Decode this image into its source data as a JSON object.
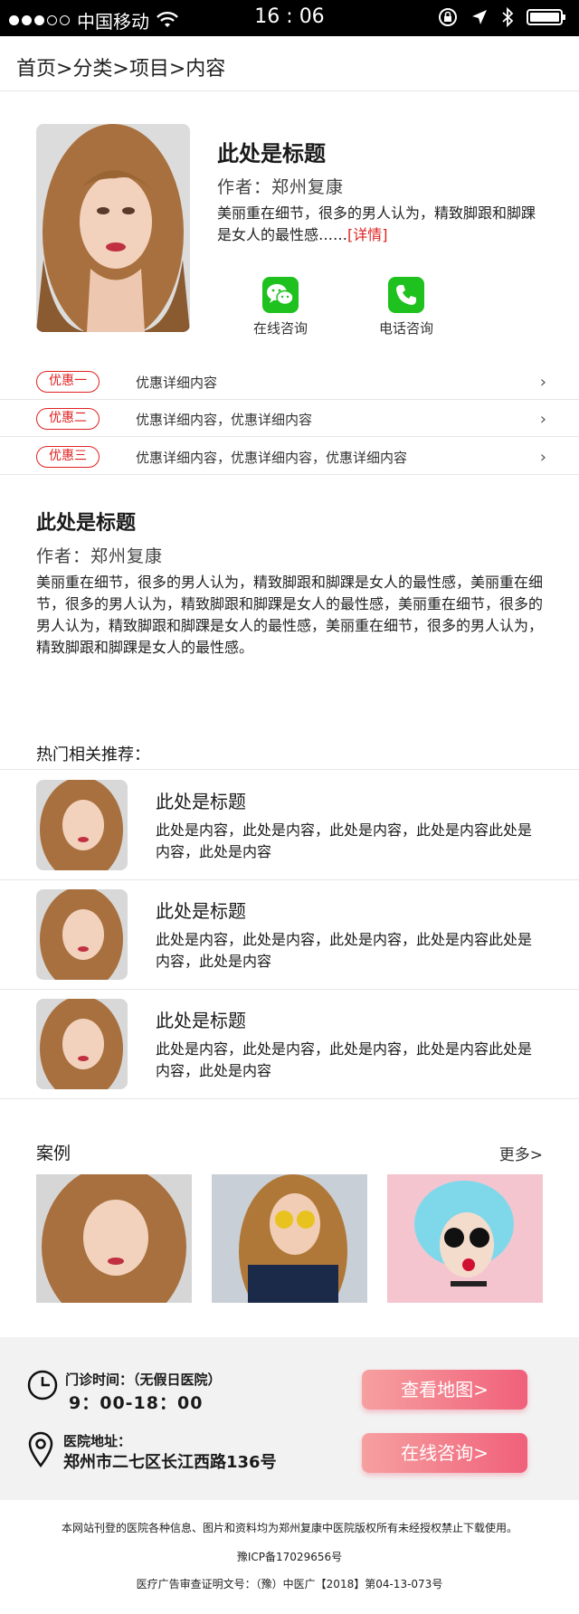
{
  "status_bar": {
    "carrier": "中国移动",
    "time": "16 : 06"
  },
  "breadcrumb": "首页>分类>项目>内容",
  "hero": {
    "title": "此处是标题",
    "author": "作者：郑州复康",
    "description": "美丽重在细节，很多的男人认为，精致脚跟和脚踝是女人的最性感……",
    "detail_link": "[详情]",
    "contact": [
      {
        "label": "在线咨询",
        "icon": "wechat-icon"
      },
      {
        "label": "电话咨询",
        "icon": "phone-icon"
      }
    ]
  },
  "offers": [
    {
      "tag": "优惠一",
      "text": "优惠详细内容"
    },
    {
      "tag": "优惠二",
      "text": "优惠详细内容，优惠详细内容"
    },
    {
      "tag": "优惠三",
      "text": "优惠详细内容，优惠详细内容，优惠详细内容"
    }
  ],
  "article": {
    "title": "此处是标题",
    "author": "作者：郑州复康",
    "body": "美丽重在细节，很多的男人认为，精致脚跟和脚踝是女人的最性感，美丽重在细节，很多的男人认为，精致脚跟和脚踝是女人的最性感，美丽重在细节，很多的男人认为，精致脚跟和脚踝是女人的最性感，美丽重在细节，很多的男人认为，精致脚跟和脚踝是女人的最性感。"
  },
  "recommended": {
    "heading": "热门相关推荐：",
    "items": [
      {
        "title": "此处是标题",
        "content": "此处是内容，此处是内容，此处是内容，此处是内容此处是内容，此处是内容"
      },
      {
        "title": "此处是标题",
        "content": "此处是内容，此处是内容，此处是内容，此处是内容此处是内容，此处是内容"
      },
      {
        "title": "此处是标题",
        "content": "此处是内容，此处是内容，此处是内容，此处是内容此处是内容，此处是内容"
      }
    ]
  },
  "cases": {
    "heading": "案例",
    "more": "更多>"
  },
  "info": {
    "hours_label": "门诊时间：（无假日医院）",
    "hours_value": "9：00-18：00",
    "address_label": "医院地址：",
    "address_value": "郑州市二七区长江西路136号",
    "map_button": "查看地图>",
    "consult_button": "在线咨询>"
  },
  "footer": {
    "copyright": "本网站刊登的医院各种信息、图片和资料均为郑州复康中医院版权所有未经授权禁止下载使用。",
    "icp": "豫ICP备17029656号",
    "ad_cert": "医疗广告审查证明文号：（豫）中医广【2018】第04-13-073号"
  },
  "colors": {
    "accent_red": "#e02020",
    "wechat_green": "#1ec11e",
    "button_gradient_start": "#f6a0a0",
    "button_gradient_end": "#f0607a"
  }
}
